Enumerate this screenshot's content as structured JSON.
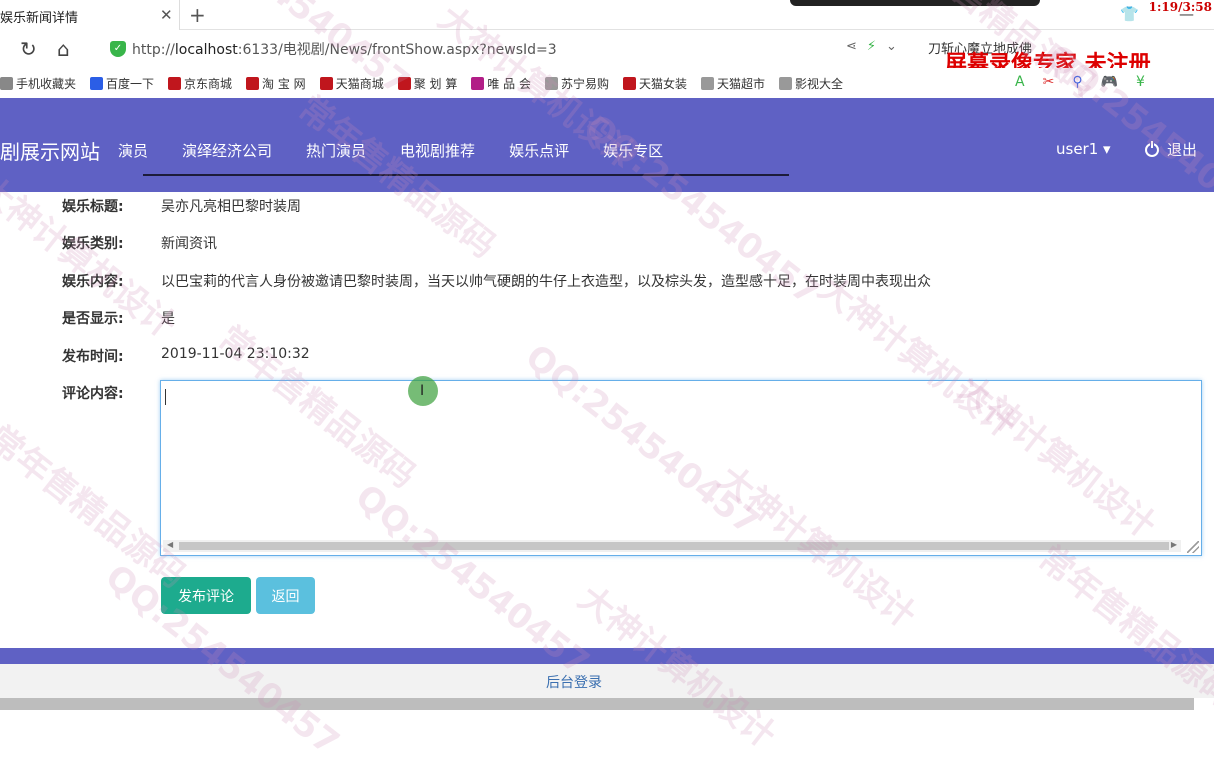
{
  "browser": {
    "tab_title": "娱乐新闻详情",
    "tab_close": "✕",
    "new_tab": "+",
    "clock": "1:19/3:58",
    "url_prefix": "http://",
    "url_host": "localhost",
    "url_rest": ":6133/电视剧/News/frontShow.aspx?newsId=3",
    "search_text": "刀斩心魔立地成佛",
    "recorder_label": "屏幕录像专家 未注册",
    "bookmarks": [
      {
        "label": "手机收藏夹",
        "icon": "folder-icon",
        "color": "#888"
      },
      {
        "label": "百度一下",
        "icon": "baidu-icon",
        "color": "#2b5ee6"
      },
      {
        "label": "京东商城",
        "icon": "jd-icon",
        "color": "#c0161d"
      },
      {
        "label": "淘 宝 网",
        "icon": "taobao-icon",
        "color": "#c0161d"
      },
      {
        "label": "天猫商城",
        "icon": "tmall-icon",
        "color": "#c0161d"
      },
      {
        "label": "聚 划 算",
        "icon": "juhuasuan-icon",
        "color": "#c0161d"
      },
      {
        "label": "唯 品 会",
        "icon": "vip-icon",
        "color": "#b21e87"
      },
      {
        "label": "苏宁易购",
        "icon": "page-icon",
        "color": "#999"
      },
      {
        "label": "天猫女装",
        "icon": "tmall-icon",
        "color": "#c0161d"
      },
      {
        "label": "天猫超市",
        "icon": "page-icon",
        "color": "#999"
      },
      {
        "label": "影视大全",
        "icon": "page-icon",
        "color": "#999"
      }
    ]
  },
  "site": {
    "brand": "剧展示网站",
    "menu": [
      "演员",
      "演绎经济公司",
      "热门演员",
      "电视剧推荐",
      "娱乐点评",
      "娱乐专区"
    ],
    "user": "user1 ▾",
    "logout": "退出",
    "nav_color": "#5f61c4"
  },
  "detail": {
    "title_label": "娱乐标题:",
    "title_value": "吴亦凡亮相巴黎时装周",
    "category_label": "娱乐类别:",
    "category_value": "新闻资讯",
    "content_label": "娱乐内容:",
    "content_value": "以巴宝莉的代言人身份被邀请巴黎时装周，当天以帅气硬朗的牛仔上衣造型，以及棕头发，造型感十足，在时装周中表现出众",
    "show_label": "是否显示:",
    "show_value": "是",
    "time_label": "发布时间:",
    "time_value": "2019-11-04 23:10:32",
    "comment_label": "评论内容:",
    "comment_value": ""
  },
  "buttons": {
    "publish": "发布评论",
    "back": "返回"
  },
  "footer": {
    "admin_login": "后台登录"
  },
  "watermarks": [
    "QQ:254540457",
    "大神计算机设计",
    "常年售精品源码"
  ]
}
